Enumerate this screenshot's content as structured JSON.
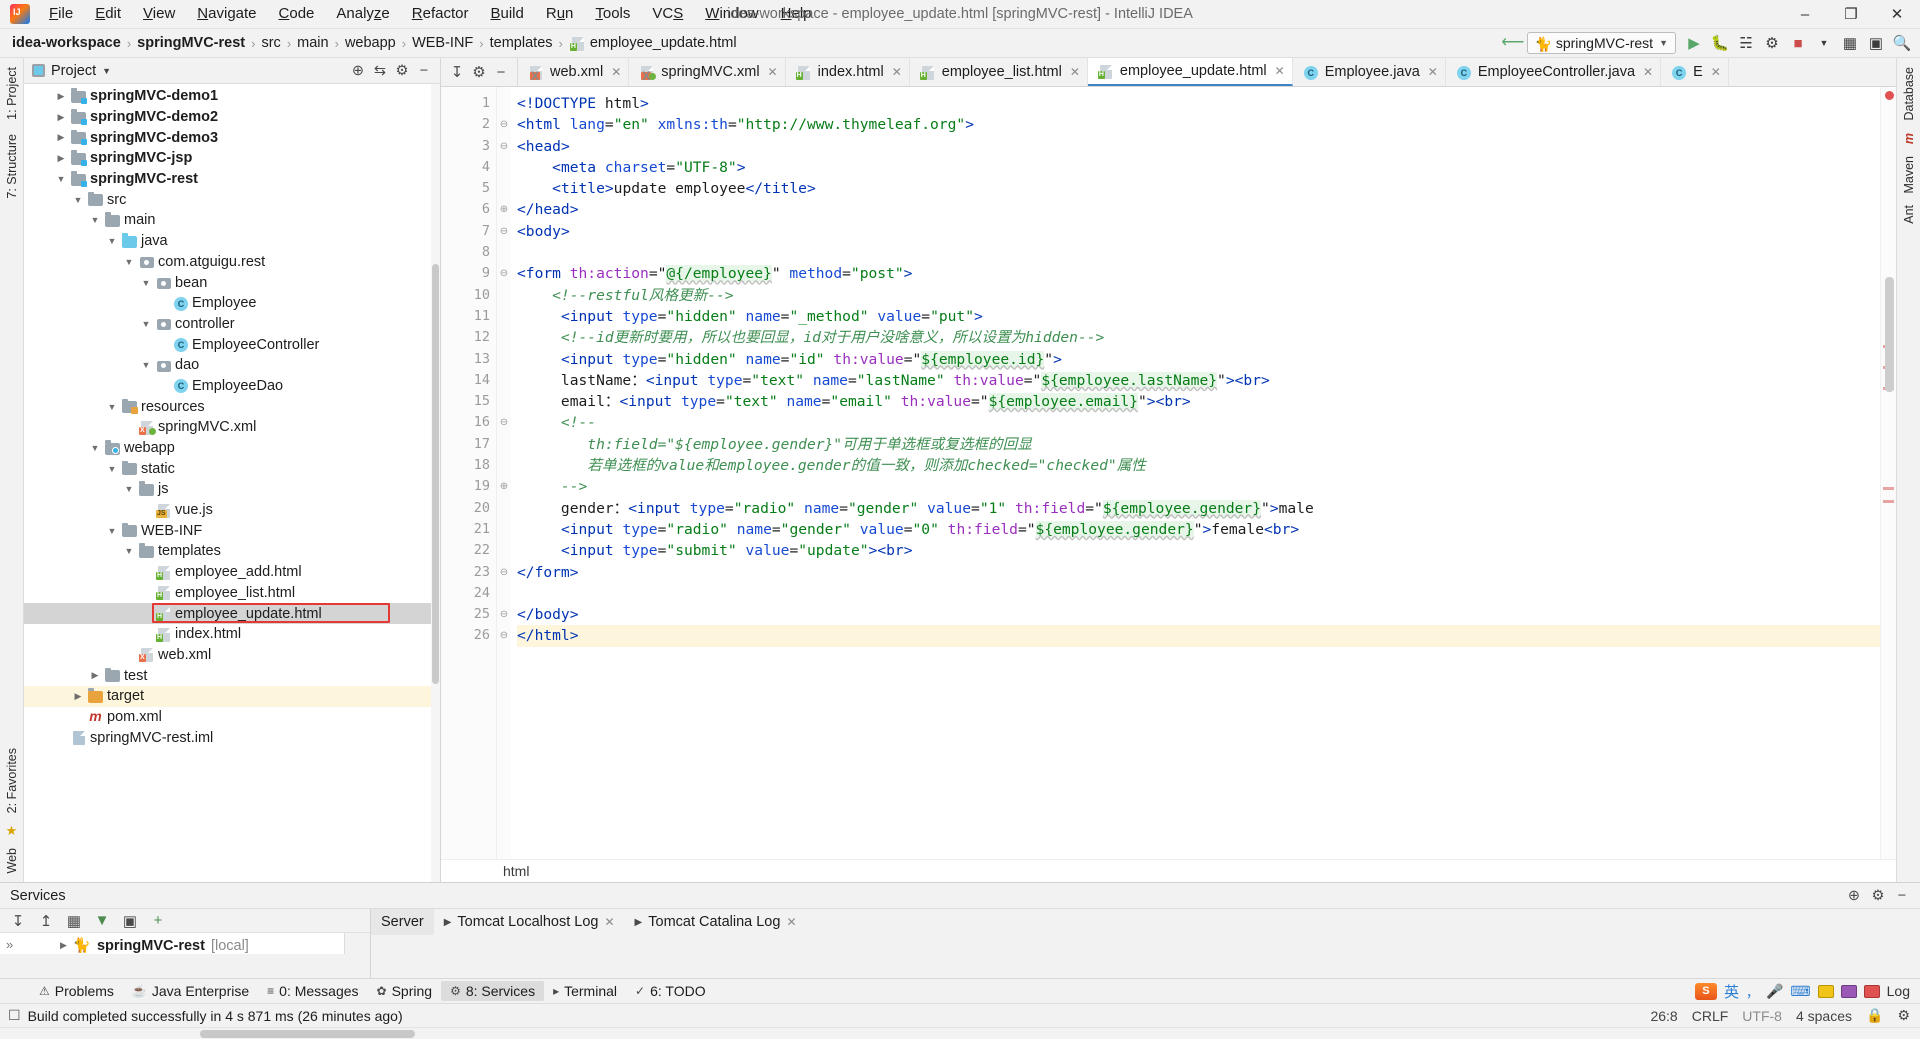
{
  "window": {
    "title": "idea-workspace - employee_update.html [springMVC-rest] - IntelliJ IDEA",
    "minimize": "–",
    "maximize": "❐",
    "close": "✕"
  },
  "menubar": {
    "items": [
      {
        "label": "File"
      },
      {
        "label": "Edit"
      },
      {
        "label": "View"
      },
      {
        "label": "Navigate"
      },
      {
        "label": "Code"
      },
      {
        "label": "Analyze"
      },
      {
        "label": "Refactor"
      },
      {
        "label": "Build"
      },
      {
        "label": "Run"
      },
      {
        "label": "Tools"
      },
      {
        "label": "VCS"
      },
      {
        "label": "Window"
      },
      {
        "label": "Help"
      }
    ]
  },
  "breadcrumb": {
    "items": [
      "idea-workspace",
      "springMVC-rest",
      "src",
      "main",
      "webapp",
      "WEB-INF",
      "templates",
      "employee_update.html"
    ],
    "separator": "›"
  },
  "navbar_right": {
    "run_config": "springMVC-rest",
    "icons": [
      "hammer-icon",
      "run-icon",
      "debug-icon",
      "coverage-icon",
      "profile-icon",
      "stop-icon",
      "chevron-down-icon",
      "search-everywhere-icon",
      "layout-icon"
    ]
  },
  "project_panel": {
    "title": "Project",
    "header_icons": [
      "locate-icon",
      "collapse-all-icon",
      "settings-icon",
      "hide-icon"
    ],
    "tree": [
      {
        "indent": 1,
        "arrow": "▶",
        "icon": "module-folder",
        "label": "springMVC-demo1",
        "bold": true
      },
      {
        "indent": 1,
        "arrow": "▶",
        "icon": "module-folder",
        "label": "springMVC-demo2",
        "bold": true
      },
      {
        "indent": 1,
        "arrow": "▶",
        "icon": "module-folder",
        "label": "springMVC-demo3",
        "bold": true
      },
      {
        "indent": 1,
        "arrow": "▶",
        "icon": "module-folder",
        "label": "springMVC-jsp",
        "bold": true
      },
      {
        "indent": 1,
        "arrow": "▼",
        "icon": "module-folder",
        "label": "springMVC-rest",
        "bold": true
      },
      {
        "indent": 2,
        "arrow": "▼",
        "icon": "folder",
        "label": "src",
        "bold": false
      },
      {
        "indent": 3,
        "arrow": "▼",
        "icon": "folder",
        "label": "main",
        "bold": false
      },
      {
        "indent": 4,
        "arrow": "▼",
        "icon": "source-folder",
        "label": "java",
        "bold": false
      },
      {
        "indent": 5,
        "arrow": "▼",
        "icon": "package",
        "label": "com.atguigu.rest",
        "bold": false
      },
      {
        "indent": 6,
        "arrow": "▼",
        "icon": "package",
        "label": "bean",
        "bold": false
      },
      {
        "indent": 7,
        "arrow": "",
        "icon": "class",
        "label": "Employee",
        "bold": false
      },
      {
        "indent": 6,
        "arrow": "▼",
        "icon": "package",
        "label": "controller",
        "bold": false
      },
      {
        "indent": 7,
        "arrow": "",
        "icon": "class",
        "label": "EmployeeController",
        "bold": false
      },
      {
        "indent": 6,
        "arrow": "▼",
        "icon": "package",
        "label": "dao",
        "bold": false
      },
      {
        "indent": 7,
        "arrow": "",
        "icon": "class",
        "label": "EmployeeDao",
        "bold": false
      },
      {
        "indent": 4,
        "arrow": "▼",
        "icon": "resources-folder",
        "label": "resources",
        "bold": false
      },
      {
        "indent": 5,
        "arrow": "",
        "icon": "xml-spring-file",
        "label": "springMVC.xml",
        "bold": false
      },
      {
        "indent": 3,
        "arrow": "▼",
        "icon": "web-folder",
        "label": "webapp",
        "bold": false
      },
      {
        "indent": 4,
        "arrow": "▼",
        "icon": "folder",
        "label": "static",
        "bold": false
      },
      {
        "indent": 5,
        "arrow": "▼",
        "icon": "folder",
        "label": "js",
        "bold": false
      },
      {
        "indent": 6,
        "arrow": "",
        "icon": "js-file",
        "label": "vue.js",
        "bold": false
      },
      {
        "indent": 4,
        "arrow": "▼",
        "icon": "folder",
        "label": "WEB-INF",
        "bold": false
      },
      {
        "indent": 5,
        "arrow": "▼",
        "icon": "folder",
        "label": "templates",
        "bold": false
      },
      {
        "indent": 6,
        "arrow": "",
        "icon": "html-file",
        "label": "employee_add.html",
        "bold": false
      },
      {
        "indent": 6,
        "arrow": "",
        "icon": "html-file",
        "label": "employee_list.html",
        "bold": false
      },
      {
        "indent": 6,
        "arrow": "",
        "icon": "html-file",
        "label": "employee_update.html",
        "bold": false,
        "selected": true,
        "highlight_box": true
      },
      {
        "indent": 6,
        "arrow": "",
        "icon": "html-file",
        "label": "index.html",
        "bold": false
      },
      {
        "indent": 5,
        "arrow": "",
        "icon": "xml-file",
        "label": "web.xml",
        "bold": false
      },
      {
        "indent": 3,
        "arrow": "▶",
        "icon": "folder",
        "label": "test",
        "bold": false
      },
      {
        "indent": 2,
        "arrow": "▶",
        "icon": "target-folder",
        "label": "target",
        "bold": false,
        "yellow": true
      },
      {
        "indent": 2,
        "arrow": "",
        "icon": "maven-file",
        "label": "pom.xml",
        "bold": false
      },
      {
        "indent": 1,
        "arrow": "",
        "icon": "iml-file",
        "label": "springMVC-rest.iml",
        "bold": false
      }
    ]
  },
  "left_rail": {
    "top_labels": [
      "1: Project"
    ],
    "mid_labels": [
      "7: Structure"
    ],
    "bottom_labels": [
      "2: Favorites",
      "Web"
    ]
  },
  "right_rail": {
    "labels": [
      "Database",
      "m",
      "Maven",
      "Ant"
    ]
  },
  "editor": {
    "tabs": [
      {
        "label": "web.xml",
        "icon": "xml-file",
        "active": false
      },
      {
        "label": "springMVC.xml",
        "icon": "xml-spring-file",
        "active": false
      },
      {
        "label": "index.html",
        "icon": "html-file",
        "active": false
      },
      {
        "label": "employee_list.html",
        "icon": "html-file",
        "active": false
      },
      {
        "label": "employee_update.html",
        "icon": "html-file",
        "active": true
      },
      {
        "label": "Employee.java",
        "icon": "class",
        "active": false
      },
      {
        "label": "EmployeeController.java",
        "icon": "class",
        "active": false
      },
      {
        "label": "E",
        "icon": "class",
        "active": false
      }
    ],
    "close_glyph": "✕",
    "breadcrumb_bottom": "html",
    "lines": [
      {
        "n": 1,
        "fold": "",
        "hl": false
      },
      {
        "n": 2,
        "fold": "⊖",
        "hl": false
      },
      {
        "n": 3,
        "fold": "⊖",
        "hl": false
      },
      {
        "n": 4,
        "fold": "",
        "hl": false
      },
      {
        "n": 5,
        "fold": "",
        "hl": false
      },
      {
        "n": 6,
        "fold": "⊕",
        "hl": false
      },
      {
        "n": 7,
        "fold": "⊖",
        "hl": false
      },
      {
        "n": 8,
        "fold": "",
        "hl": false
      },
      {
        "n": 9,
        "fold": "⊖",
        "hl": false
      },
      {
        "n": 10,
        "fold": "",
        "hl": false
      },
      {
        "n": 11,
        "fold": "",
        "hl": false
      },
      {
        "n": 12,
        "fold": "",
        "hl": false
      },
      {
        "n": 13,
        "fold": "",
        "hl": false
      },
      {
        "n": 14,
        "fold": "",
        "hl": false
      },
      {
        "n": 15,
        "fold": "",
        "hl": false
      },
      {
        "n": 16,
        "fold": "⊖",
        "hl": false
      },
      {
        "n": 17,
        "fold": "",
        "hl": false
      },
      {
        "n": 18,
        "fold": "",
        "hl": false
      },
      {
        "n": 19,
        "fold": "⊕",
        "hl": false
      },
      {
        "n": 20,
        "fold": "",
        "hl": false
      },
      {
        "n": 21,
        "fold": "",
        "hl": false
      },
      {
        "n": 22,
        "fold": "",
        "hl": false
      },
      {
        "n": 23,
        "fold": "⊖",
        "hl": false
      },
      {
        "n": 24,
        "fold": "",
        "hl": false
      },
      {
        "n": 25,
        "fold": "⊖",
        "hl": false
      },
      {
        "n": 26,
        "fold": "⊖",
        "hl": true
      }
    ],
    "source_text": [
      "<!DOCTYPE html>",
      "<html lang=\"en\" xmlns:th=\"http://www.thymeleaf.org\">",
      "<head>",
      "    <meta charset=\"UTF-8\">",
      "    <title>update employee</title>",
      "</head>",
      "<body>",
      "",
      "<form th:action=\"@{/employee}\" method=\"post\">",
      "    <!--restful风格更新-->",
      "     <input type=\"hidden\" name=\"_method\" value=\"put\">",
      "     <!--id更新时要用，所以也要回显，id对于用户没啥意义，所以设置为hidden-->",
      "     <input type=\"hidden\" name=\"id\" th:value=\"${employee.id}\">",
      "     lastName：<input type=\"text\" name=\"lastName\" th:value=\"${employee.lastName}\"><br>",
      "     email：<input type=\"text\" name=\"email\" th:value=\"${employee.email}\"><br>",
      "     <!--",
      "        th:field=\"${employee.gender}\"可用于单选框或复选框的回显",
      "        若单选框的value和employee.gender的值一致，则添加checked=\"checked\"属性",
      "     -->",
      "     gender：<input type=\"radio\" name=\"gender\" value=\"1\" th:field=\"${employee.gender}\">male",
      "     <input type=\"radio\" name=\"gender\" value=\"0\" th:field=\"${employee.gender}\">female<br>",
      "     <input type=\"submit\" value=\"update\"><br>",
      "</form>",
      "",
      "</body>",
      "</html>"
    ]
  },
  "services": {
    "title": "Services",
    "toolbar_icons": [
      "collapse-icon",
      "expand-icon",
      "group-icon",
      "filter-icon",
      "run-dashboard-icon",
      "add-icon"
    ],
    "side_icons": [
      "settings-icon",
      "hide-icon"
    ],
    "tabs": [
      {
        "label": "Server",
        "closeable": false,
        "active": true
      },
      {
        "label": "Tomcat Localhost Log",
        "closeable": true,
        "active": false
      },
      {
        "label": "Tomcat Catalina Log",
        "closeable": true,
        "active": false
      }
    ],
    "tree_item": "springMVC-rest",
    "tree_item_suffix": "[local]",
    "more_glyph": "»"
  },
  "toolstrip": {
    "items": [
      {
        "label": "Problems",
        "icon": "warning-icon",
        "active": false
      },
      {
        "label": "Java Enterprise",
        "icon": "java-icon",
        "active": false
      },
      {
        "label": "0: Messages",
        "icon": "messages-icon",
        "active": false
      },
      {
        "label": "Spring",
        "icon": "spring-icon",
        "active": false
      },
      {
        "label": "8: Services",
        "icon": "services-icon",
        "active": true
      },
      {
        "label": "Terminal",
        "icon": "terminal-icon",
        "active": false
      },
      {
        "label": "6: TODO",
        "icon": "todo-icon",
        "active": false
      }
    ],
    "right_icons": [
      "ime-s-icon",
      "chinese-icon",
      "comma-icon",
      "mic-icon",
      "keyboard-icon",
      "yellow-icon",
      "purple-icon",
      "red-icon"
    ],
    "ime_labels": [
      "S",
      "英",
      "，",
      "Log"
    ]
  },
  "statusbar": {
    "message": "Build completed successfully in 4 s 871 ms (26 minutes ago)",
    "build_icon": "build-icon",
    "caret_position": "26:8",
    "line_separator": "CRLF",
    "encoding": "UTF-8",
    "indent": "4 spaces",
    "lock_icon": "lock-icon",
    "git_icon": "git-icon"
  }
}
